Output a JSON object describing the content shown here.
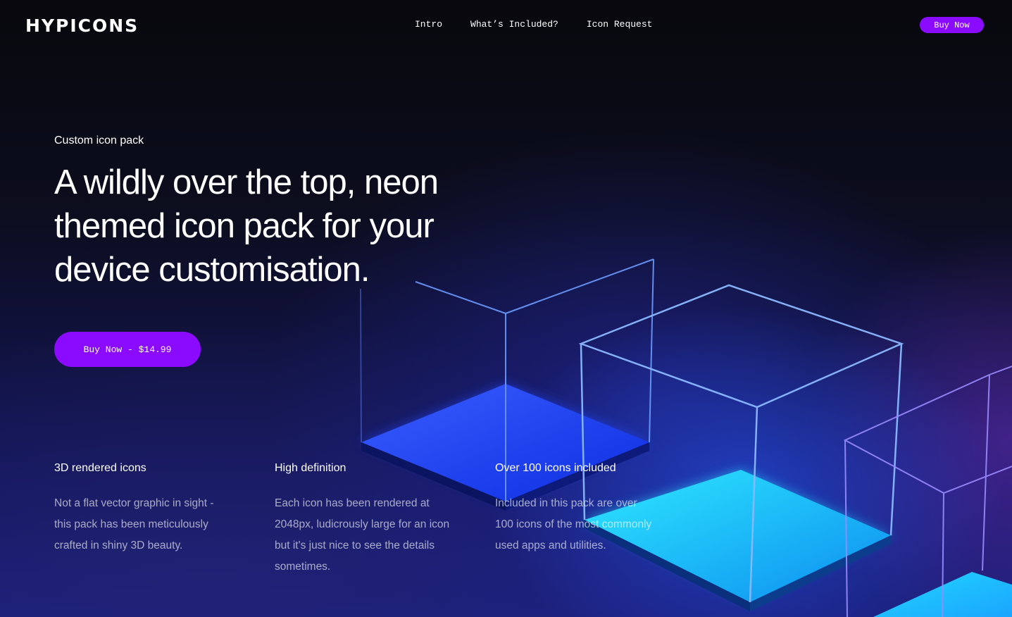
{
  "brand": {
    "logo": "HYPICONS"
  },
  "nav": {
    "items": [
      "Intro",
      "What’s Included?",
      "Icon Request"
    ]
  },
  "header": {
    "buy_label": "Buy Now",
    "accent": "#8a0bff"
  },
  "hero": {
    "eyebrow": "Custom icon pack",
    "title": "A wildly over the top, neon themed icon pack for your device customisation.",
    "cta_label": "Buy Now - $14.99"
  },
  "features": [
    {
      "title": "3D rendered icons",
      "body": "Not a flat vector graphic in sight - this pack has been meticulously crafted in shiny 3D beauty."
    },
    {
      "title": "High definition",
      "body": "Each icon has been rendered at 2048px, ludicrously large for an icon but it's just nice to see the details sometimes."
    },
    {
      "title": "Over 100 icons included",
      "body": "Included in this pack are over 100 icons of the most commonly used apps and utilities."
    }
  ]
}
